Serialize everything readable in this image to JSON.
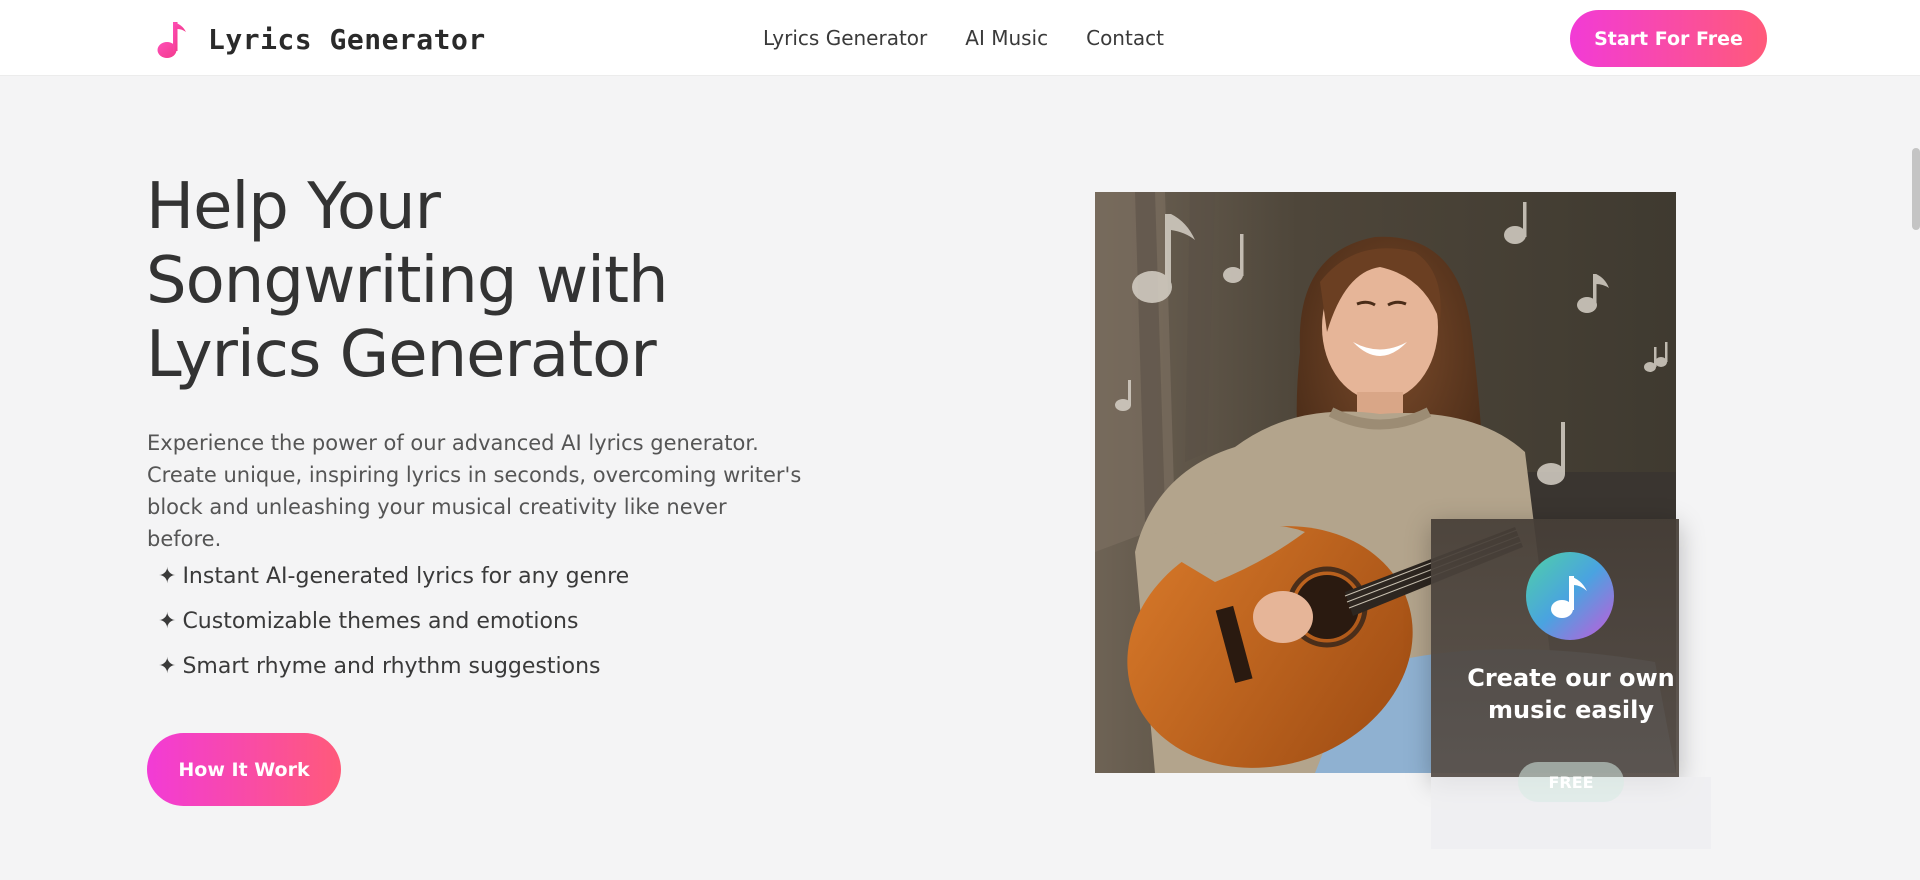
{
  "header": {
    "logo_text": "Lyrics Generator",
    "logo_icon": "music-note-icon",
    "nav": [
      {
        "label": "Lyrics Generator"
      },
      {
        "label": "AI Music"
      },
      {
        "label": "Contact"
      }
    ],
    "cta_label": "Start For Free"
  },
  "hero": {
    "title_lines": [
      "Help Your",
      "Songwriting with",
      "Lyrics Generator"
    ],
    "description_lines": [
      "Experience the power of our advanced AI lyrics generator.",
      "Create unique, inspiring lyrics in seconds, overcoming writer's",
      "block and unleashing your musical creativity like never before."
    ],
    "features": [
      {
        "icon": "✦",
        "text": "Instant AI-generated lyrics for any genre"
      },
      {
        "icon": "✦",
        "text": "Customizable themes and emotions"
      },
      {
        "icon": "✦",
        "text": "Smart rhyme and rhythm suggestions"
      }
    ],
    "button_label": "How It Work"
  },
  "card": {
    "icon": "music-note-icon",
    "title_lines": [
      "Create our own",
      "music easily"
    ],
    "badge": "FREE"
  },
  "colors": {
    "accent_start": "#f23bd6",
    "accent_end": "#ff5a7a",
    "background": "#f4f4f5",
    "text": "#333333"
  }
}
